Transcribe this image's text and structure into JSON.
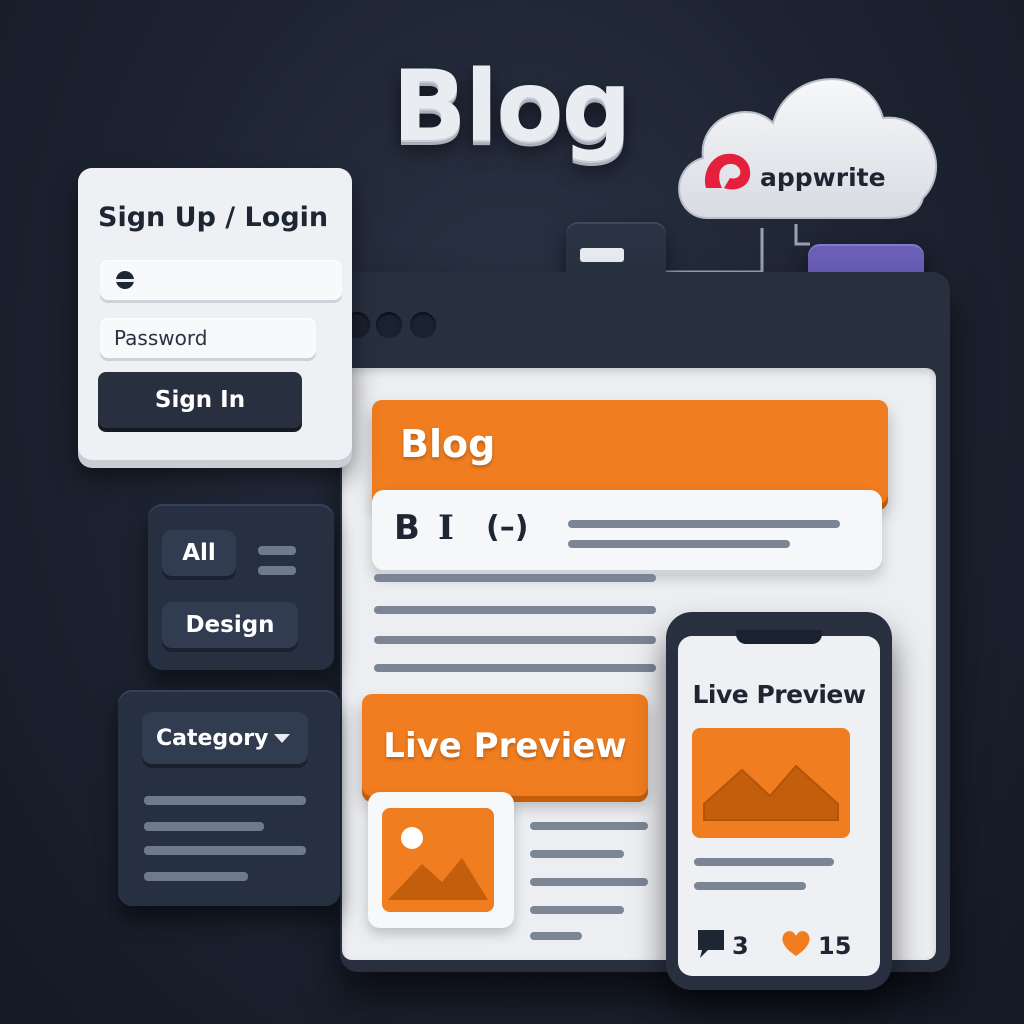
{
  "hero": {
    "title": "Blog"
  },
  "cloud": {
    "brand_label": "appwrite",
    "brand_color": "#e5203c",
    "icon": "cloud-icon"
  },
  "login": {
    "title": "Sign Up / Login",
    "email_value": "",
    "password_placeholder": "Password",
    "signin_label": "Sign In"
  },
  "filters": {
    "all_label": "All",
    "design_label": "Design"
  },
  "category": {
    "select_label": "Category"
  },
  "editor": {
    "title_value": "Blog",
    "toolbar": {
      "bold": "B",
      "italic": "I",
      "link": "(–)"
    },
    "live_preview_label": "Live Preview"
  },
  "phone": {
    "title": "Live Preview",
    "comments_count": "3",
    "likes_count": "15"
  },
  "colors": {
    "accent": "#f07d1f",
    "dark": "#283040",
    "folder": "#6b5fb8",
    "light": "#eceef2"
  }
}
